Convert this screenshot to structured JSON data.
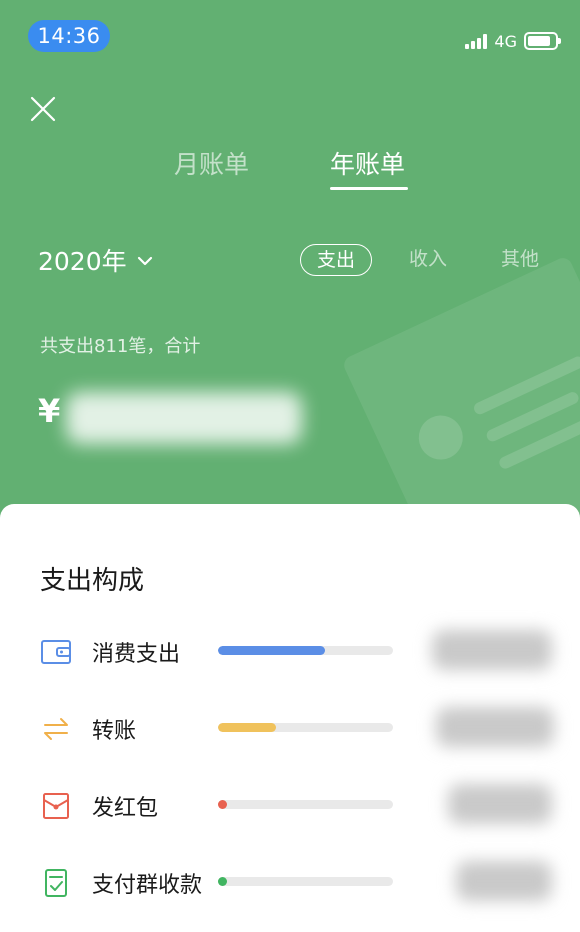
{
  "status": {
    "time": "14:36",
    "network": "4G"
  },
  "tabs": {
    "month": "月账单",
    "year": "年账单"
  },
  "filters": {
    "year_label": "2020年",
    "expense": "支出",
    "income": "收入",
    "other": "其他"
  },
  "summary": {
    "text": "共支出811笔，合计",
    "currency": "¥"
  },
  "sheet": {
    "title": "支出构成",
    "items": [
      {
        "label": "消费支出",
        "icon": "wallet-icon",
        "color": "#5b8ee6",
        "progress": 0.61
      },
      {
        "label": "转账",
        "icon": "transfer-arrows-icon",
        "color": "#f0c25c",
        "progress": 0.33
      },
      {
        "label": "发红包",
        "icon": "red-envelope-icon",
        "color": "#e8614f",
        "progress": 0.03
      },
      {
        "label": "支付群收款",
        "icon": "group-payment-icon",
        "color": "#41b561",
        "progress": 0.03
      }
    ]
  },
  "colors": {
    "header_bg": "#62b072",
    "accent_blue": "#3a8cf0"
  }
}
